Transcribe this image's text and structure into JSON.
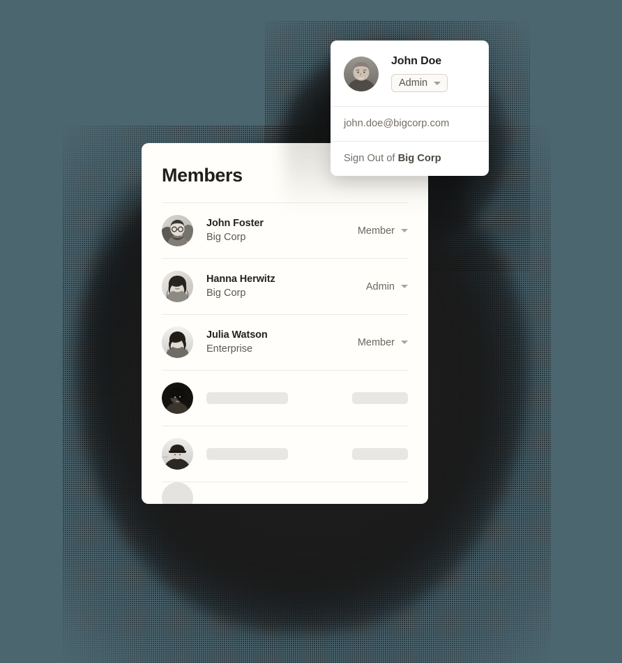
{
  "theme": {
    "page_background": "#4C6670",
    "card_background": "#FFFEFA",
    "popover_background": "#FFFFFF",
    "text_primary": "#26221F",
    "text_secondary": "#6B665F",
    "divider": "#ECEAE6",
    "skeleton": "#E8E7E4",
    "badge_border": "#D9D3C9"
  },
  "members_card": {
    "title": "Members",
    "rows": [
      {
        "name": "John Foster",
        "organization": "Big Corp",
        "role": "Member",
        "avatar": "avatar-john-foster",
        "state": "loaded"
      },
      {
        "name": "Hanna Herwitz",
        "organization": "Big Corp",
        "role": "Admin",
        "avatar": "avatar-hanna-herwitz",
        "state": "loaded"
      },
      {
        "name": "Julia Watson",
        "organization": "Enterprise",
        "role": "Member",
        "avatar": "avatar-julia-watson",
        "state": "loaded"
      },
      {
        "name": "",
        "organization": "",
        "role": "",
        "avatar": "avatar-placeholder-4",
        "state": "loading"
      },
      {
        "name": "",
        "organization": "",
        "role": "",
        "avatar": "avatar-placeholder-5",
        "state": "loading"
      },
      {
        "name": "",
        "organization": "",
        "role": "",
        "avatar": "avatar-placeholder-6",
        "state": "loading-partial"
      }
    ]
  },
  "account_popover": {
    "name": "John Doe",
    "avatar": "avatar-john-doe",
    "role_badge": {
      "label": "Admin",
      "icon": "chevron-down-icon"
    },
    "email": "john.doe@bigcorp.com",
    "sign_out": {
      "prefix": "Sign Out of ",
      "organization": "Big Corp"
    }
  },
  "icons": {
    "row_role_caret": "chevron-down-icon"
  }
}
